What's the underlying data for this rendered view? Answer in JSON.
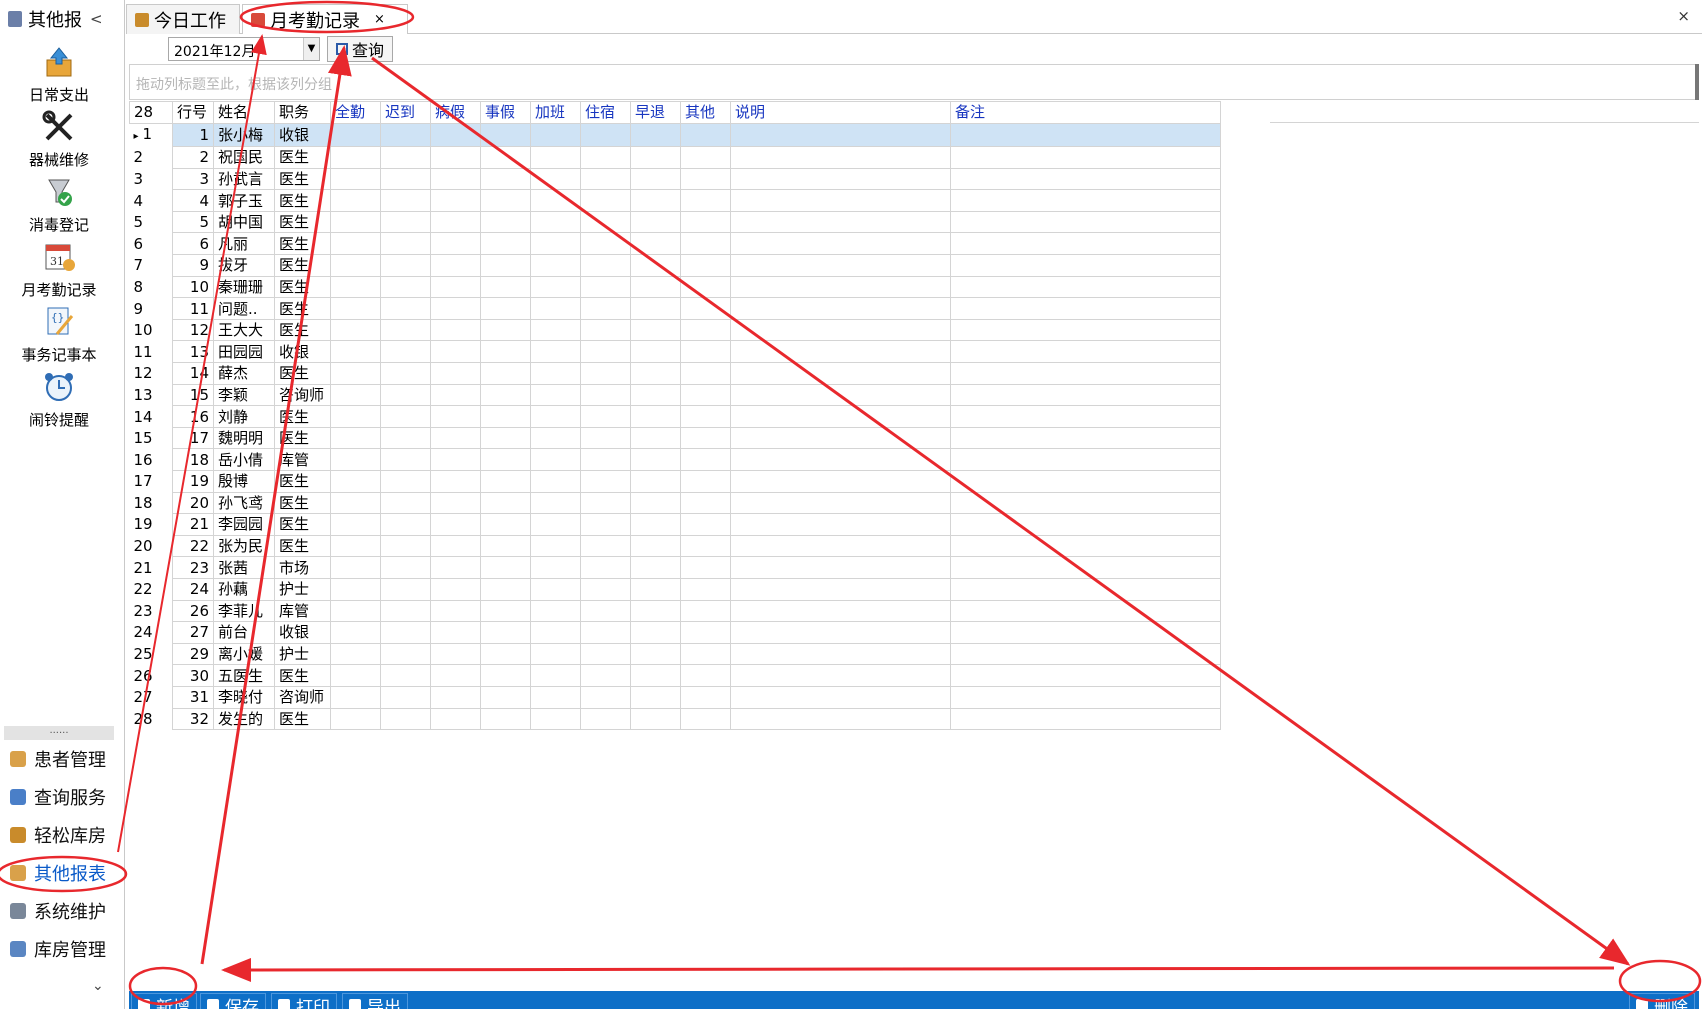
{
  "left_panel": {
    "title": "其他报",
    "collapse_glyph": "<",
    "tools": [
      {
        "label": "日常支出",
        "icon": "expense-icon"
      },
      {
        "label": "器械维修",
        "icon": "tools-icon"
      },
      {
        "label": "消毒登记",
        "icon": "disinfect-icon"
      },
      {
        "label": "月考勤记录",
        "icon": "calendar-icon"
      },
      {
        "label": "事务记事本",
        "icon": "notepad-icon"
      },
      {
        "label": "闹铃提醒",
        "icon": "alarm-clock-icon"
      }
    ],
    "separator": "......",
    "nav": [
      {
        "label": "患者管理",
        "icon": "patients-icon"
      },
      {
        "label": "查询服务",
        "icon": "query-icon"
      },
      {
        "label": "轻松库房",
        "icon": "warehouse-icon"
      },
      {
        "label": "其他报表",
        "icon": "report-icon"
      },
      {
        "label": "系统维护",
        "icon": "settings-icon"
      },
      {
        "label": "库房管理",
        "icon": "inventory-icon"
      }
    ],
    "more_glyph": "⌄"
  },
  "tabs": [
    {
      "label": "今日工作",
      "icon": "home-icon"
    },
    {
      "label": "月考勤记录",
      "icon": "calendar-icon",
      "close": "×"
    }
  ],
  "window_close": "×",
  "filter": {
    "month_value": "2021年12月",
    "dropdown_glyph": "▼",
    "query_label": "查询"
  },
  "group_panel_hint": "拖动列标题至此，根据该列分组",
  "grid": {
    "row_count": "28",
    "columns": [
      "行号",
      "姓名",
      "职务",
      "全勤",
      "迟到",
      "病假",
      "事假",
      "加班",
      "住宿",
      "早退",
      "其他",
      "说明",
      "备注"
    ],
    "selected_marker": "▸",
    "rows": [
      {
        "idx": "1",
        "no": "1",
        "name": "张小梅",
        "role": "收银"
      },
      {
        "idx": "2",
        "no": "2",
        "name": "祝国民",
        "role": "医生"
      },
      {
        "idx": "3",
        "no": "3",
        "name": "孙武言",
        "role": "医生"
      },
      {
        "idx": "4",
        "no": "4",
        "name": "郭子玉",
        "role": "医生"
      },
      {
        "idx": "5",
        "no": "5",
        "name": "胡中国",
        "role": "医生"
      },
      {
        "idx": "6",
        "no": "6",
        "name": "凡丽",
        "role": "医生"
      },
      {
        "idx": "7",
        "no": "9",
        "name": "拔牙",
        "role": "医生"
      },
      {
        "idx": "8",
        "no": "10",
        "name": "秦珊珊",
        "role": "医生"
      },
      {
        "idx": "9",
        "no": "11",
        "name": "问题..",
        "role": "医生"
      },
      {
        "idx": "10",
        "no": "12",
        "name": "王大大",
        "role": "医生"
      },
      {
        "idx": "11",
        "no": "13",
        "name": "田园园",
        "role": "收银"
      },
      {
        "idx": "12",
        "no": "14",
        "name": "薛杰",
        "role": "医生"
      },
      {
        "idx": "13",
        "no": "15",
        "name": "李颖",
        "role": "咨询师"
      },
      {
        "idx": "14",
        "no": "16",
        "name": "刘静",
        "role": "医生"
      },
      {
        "idx": "15",
        "no": "17",
        "name": "魏明明",
        "role": "医生"
      },
      {
        "idx": "16",
        "no": "18",
        "name": "岳小倩",
        "role": "库管"
      },
      {
        "idx": "17",
        "no": "19",
        "name": "殷博",
        "role": "医生"
      },
      {
        "idx": "18",
        "no": "20",
        "name": "孙飞鸢",
        "role": "医生"
      },
      {
        "idx": "19",
        "no": "21",
        "name": "李园园",
        "role": "医生"
      },
      {
        "idx": "20",
        "no": "22",
        "name": "张为民",
        "role": "医生"
      },
      {
        "idx": "21",
        "no": "23",
        "name": "张茜",
        "role": "市场"
      },
      {
        "idx": "22",
        "no": "24",
        "name": "孙藕",
        "role": "护士"
      },
      {
        "idx": "23",
        "no": "26",
        "name": "李菲儿",
        "role": "库管"
      },
      {
        "idx": "24",
        "no": "27",
        "name": "前台",
        "role": "收银"
      },
      {
        "idx": "25",
        "no": "29",
        "name": "离小媛",
        "role": "护士"
      },
      {
        "idx": "26",
        "no": "30",
        "name": "五医生",
        "role": "医生"
      },
      {
        "idx": "27",
        "no": "31",
        "name": "李晓付",
        "role": "咨询师"
      },
      {
        "idx": "28",
        "no": "32",
        "name": "发生的",
        "role": "医生"
      }
    ]
  },
  "bottom_toolbar": {
    "add": "新增",
    "save": "保存",
    "print": "打印",
    "export": "导出",
    "delete": "删除"
  },
  "colors": {
    "header_blue": "#1836c0",
    "toolbar_blue": "#0e6fc7",
    "selected_row": "#cfe3f5",
    "annotation_red": "#e8282d"
  }
}
